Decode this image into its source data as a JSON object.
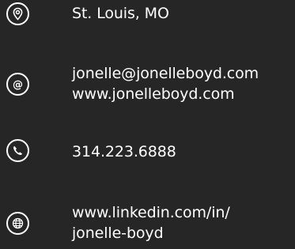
{
  "contact": {
    "location": {
      "icon": "location-pin-icon",
      "text": "St. Louis, MO"
    },
    "email": {
      "icon": "at-sign-icon",
      "address": "jonelle@jonelleboyd.com",
      "website": "www.jonelleboyd.com"
    },
    "phone": {
      "icon": "phone-icon",
      "text": "314.223.6888"
    },
    "linkedin": {
      "icon": "globe-icon",
      "line1": "www.linkedin.com/in/",
      "line2": "jonelle-boyd"
    }
  },
  "colors": {
    "background": "#262626",
    "foreground": "#ffffff"
  }
}
